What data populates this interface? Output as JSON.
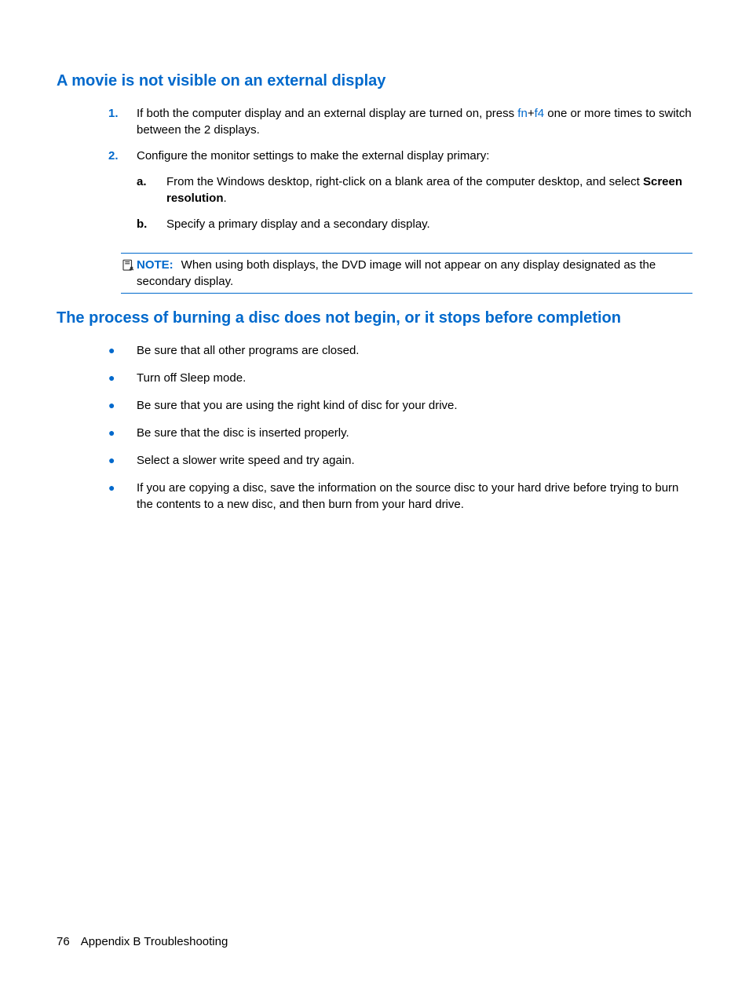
{
  "section1": {
    "heading": "A movie is not visible on an external display",
    "steps": [
      {
        "num": "1.",
        "text_before": "If both the computer display and an external display are turned on, press ",
        "link1": "fn",
        "plus": "+",
        "link2": "f4",
        "text_after": " one or more times to switch between the 2 displays."
      },
      {
        "num": "2.",
        "text": "Configure the monitor settings to make the external display primary:",
        "sub": [
          {
            "let": "a.",
            "text_before": "From the Windows desktop, right-click on a blank area of the computer desktop, and select ",
            "bold": "Screen resolution",
            "text_after": "."
          },
          {
            "let": "b.",
            "text": "Specify a primary display and a secondary display."
          }
        ]
      }
    ],
    "note": {
      "label": "NOTE:",
      "text": "When using both displays, the DVD image will not appear on any display designated as the secondary display."
    }
  },
  "section2": {
    "heading": "The process of burning a disc does not begin, or it stops before completion",
    "bullets": [
      "Be sure that all other programs are closed.",
      "Turn off Sleep mode.",
      "Be sure that you are using the right kind of disc for your drive.",
      "Be sure that the disc is inserted properly.",
      "Select a slower write speed and try again.",
      "If you are copying a disc, save the information on the source disc to your hard drive before trying to burn the contents to a new disc, and then burn from your hard drive."
    ]
  },
  "footer": {
    "page": "76",
    "chapter": "Appendix B   Troubleshooting"
  }
}
